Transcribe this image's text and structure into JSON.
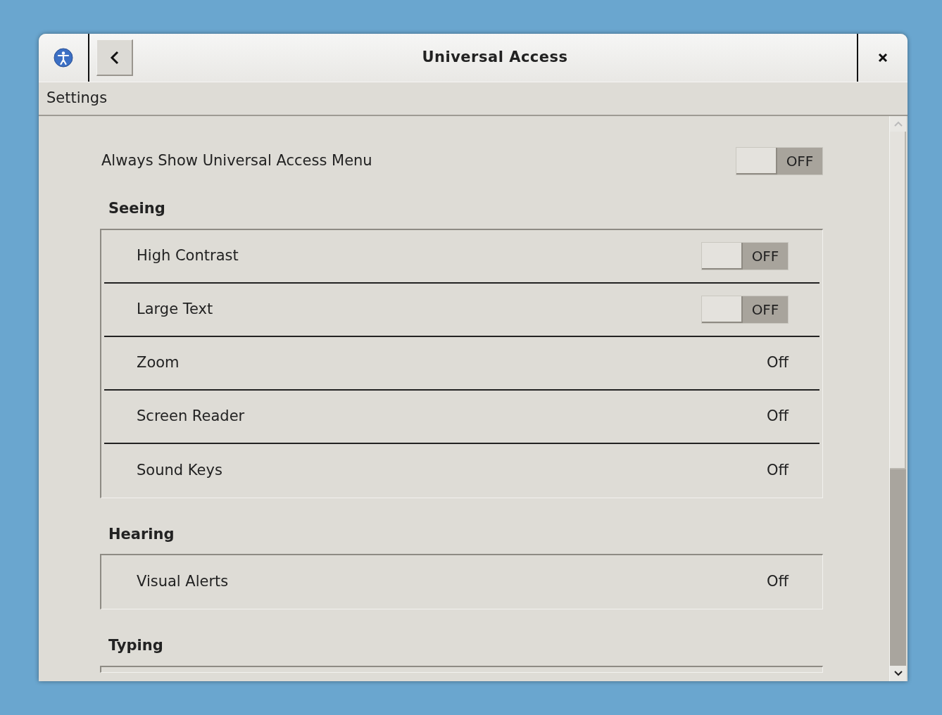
{
  "window": {
    "title": "Universal Access",
    "breadcrumb": "Settings"
  },
  "top_setting": {
    "label": "Always Show Universal Access Menu",
    "kind": "switch",
    "on": false,
    "state_label": "OFF"
  },
  "sections": [
    {
      "title": "Seeing",
      "rows": [
        {
          "label": "High Contrast",
          "kind": "switch",
          "on": false,
          "state_label": "OFF"
        },
        {
          "label": "Large Text",
          "kind": "switch",
          "on": false,
          "state_label": "OFF"
        },
        {
          "label": "Zoom",
          "kind": "value",
          "value": "Off"
        },
        {
          "label": "Screen Reader",
          "kind": "value",
          "value": "Off"
        },
        {
          "label": "Sound Keys",
          "kind": "value",
          "value": "Off"
        }
      ]
    },
    {
      "title": "Hearing",
      "rows": [
        {
          "label": "Visual Alerts",
          "kind": "value",
          "value": "Off"
        }
      ]
    },
    {
      "title": "Typing"
    }
  ]
}
